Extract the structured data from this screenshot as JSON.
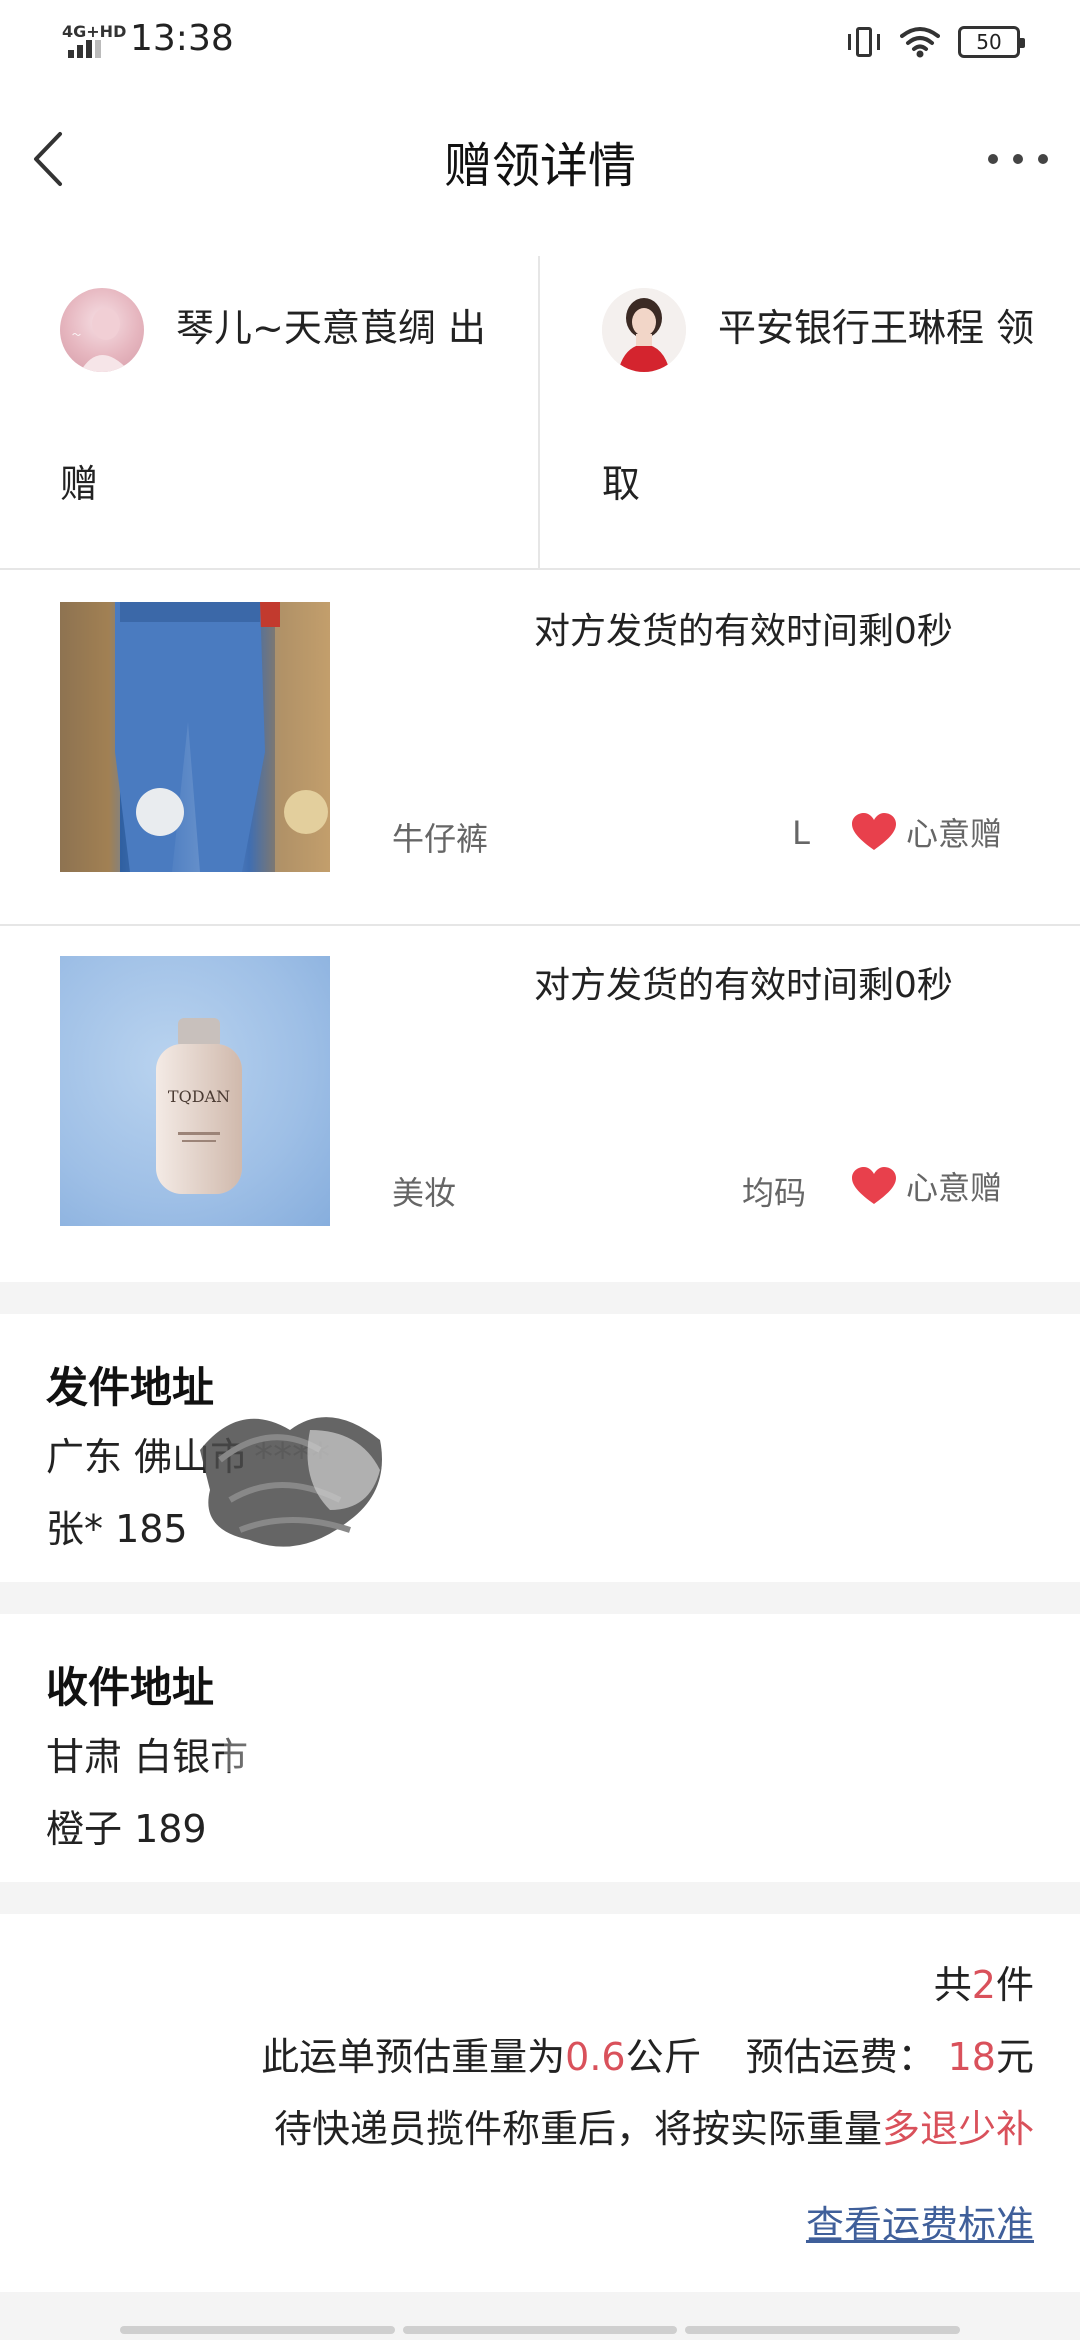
{
  "status_bar": {
    "network": "4G+HD",
    "time": "13:38",
    "battery": "50",
    "icons": [
      "vibrate-icon",
      "wifi-icon",
      "battery-icon"
    ]
  },
  "header": {
    "title": "赠领详情"
  },
  "users": {
    "giver": {
      "line1": "琴儿~天意莨绸 出",
      "line2": "赠"
    },
    "receiver": {
      "line1": "平安银行王琳程 领",
      "line2": "取"
    }
  },
  "items": [
    {
      "timer_text": "对方发货的有效时间剩0秒",
      "category": "牛仔裤",
      "size": "L",
      "gift_type": "心意赠"
    },
    {
      "timer_text": "对方发货的有效时间剩0秒",
      "category": "美妆",
      "size": "均码",
      "gift_type": "心意赠",
      "brand": "TQDAN"
    }
  ],
  "sender_address": {
    "title": "发件地址",
    "region": "广东 佛山市",
    "detail_masked": "****",
    "contact": "张* 185"
  },
  "receiver_address": {
    "title": "收件地址",
    "region": "甘肃 白银市",
    "contact": "橙子 189"
  },
  "shipping": {
    "count_prefix": "共",
    "count": "2",
    "count_suffix": "件",
    "weight_prefix": "此运单预估重量为",
    "weight": "0.6",
    "weight_unit": "公斤",
    "fee_prefix": "预估运费：",
    "fee": "18",
    "fee_unit": "元",
    "note_prefix": "待快递员揽件称重后，将按实际重量",
    "note_accent": "多退少补",
    "fee_link": "查看运费标准"
  },
  "colors": {
    "accent": "#d9515b",
    "heart": "#e8404c",
    "link": "#3f5f9a"
  }
}
